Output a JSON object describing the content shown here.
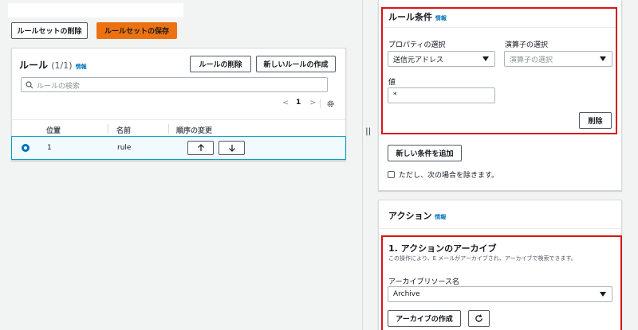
{
  "top_bar": {
    "delete_ruleset_label": "ルールセットの削除",
    "save_ruleset_label": "ルールセットの保存"
  },
  "rules_panel": {
    "title": "ルール",
    "count": "(1/1)",
    "info": "情報",
    "delete_rule_label": "ルールの削除",
    "create_rule_label": "新しいルールの作成",
    "search_placeholder": "ルールの検索",
    "page_number": "1",
    "columns": [
      "位置",
      "名前",
      "順序の変更"
    ],
    "rows": [
      {
        "position": "1",
        "name": "rule"
      }
    ]
  },
  "rule_conditions": {
    "title": "ルール条件",
    "info": "情報",
    "property_label": "プロパティの選択",
    "property_value": "送信元アドレス",
    "operator_label": "演算子の選択",
    "operator_placeholder": "演算子の選択",
    "value_label": "値",
    "value_text": "*",
    "remove_label": "削除",
    "add_condition_label": "新しい条件を追加",
    "except_label": "ただし、次の場合を除きます。"
  },
  "actions": {
    "title": "アクション",
    "info": "情報",
    "archive_title": "1. アクションのアーカイブ",
    "archive_desc": "この操作により、E メールがアーカイブされ、アーカイブで検索できます。",
    "resource_label": "アーカイブリソース名",
    "resource_value": "Archive",
    "create_archive_label": "アーカイブの作成"
  },
  "colors": {
    "accent": "#ec7211",
    "highlight": "#d91515",
    "link": "#0073bb",
    "selected_row": "#f1faff"
  }
}
